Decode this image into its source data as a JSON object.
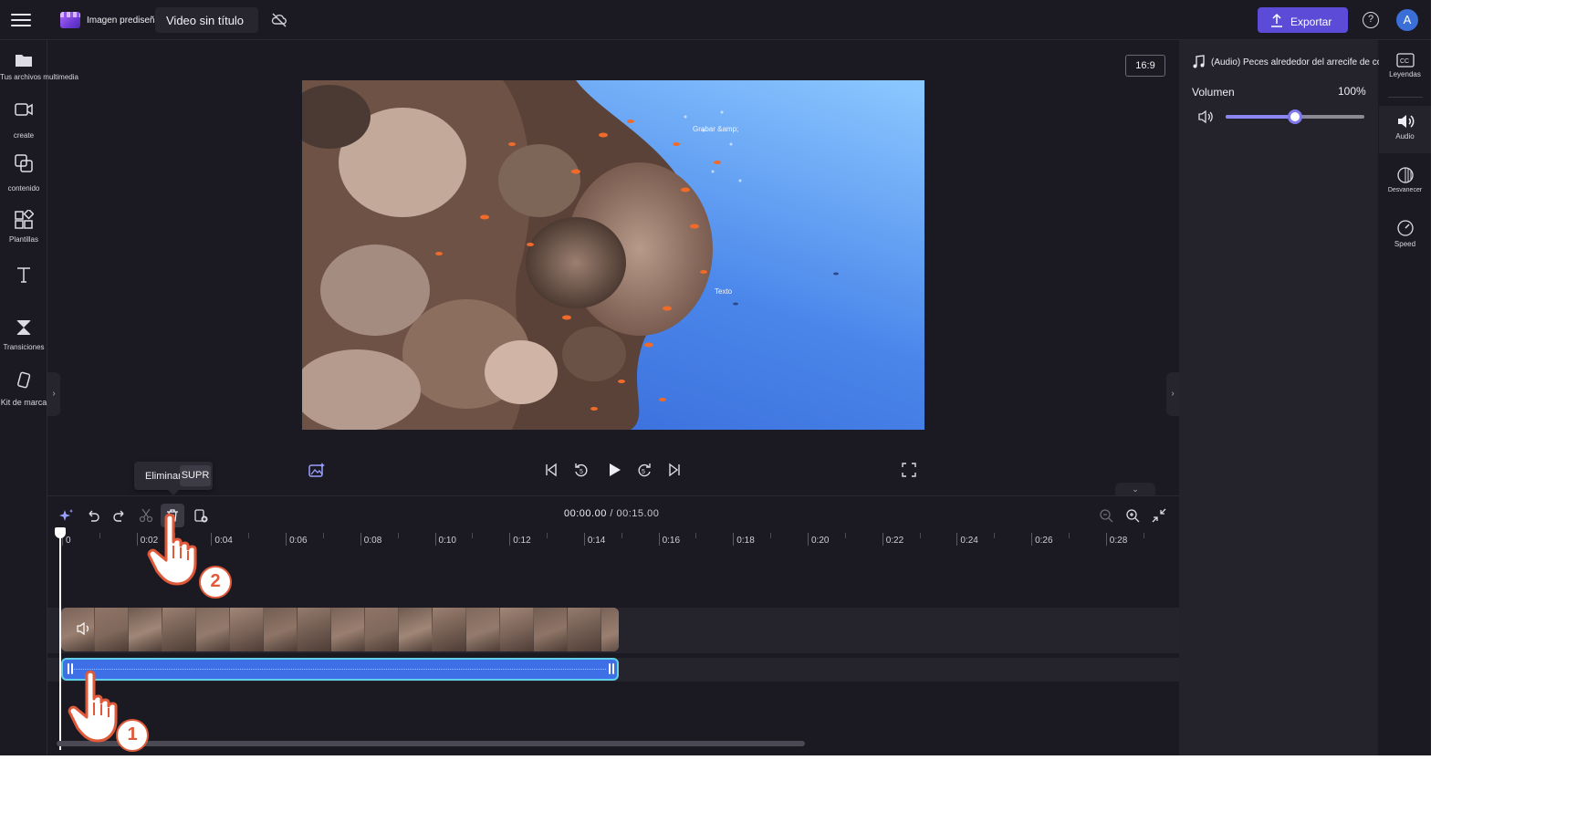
{
  "topbar": {
    "logo_text": "Imagen prediseñada",
    "project_title": "Video sin título",
    "export_label": "Exportar",
    "help_label": "?",
    "avatar_initial": "A",
    "icons": [
      "menu-icon",
      "clipchamp-logo",
      "cloud-off-icon",
      "upload-icon",
      "help-icon"
    ]
  },
  "sidebar": {
    "items": [
      {
        "label": "Tus archivos multimedia",
        "icon": "folder-icon"
      },
      {
        "label": "create",
        "icon": "camera-icon"
      },
      {
        "label": "contenido",
        "icon": "stock-content-icon"
      },
      {
        "label": "Plantillas",
        "icon": "templates-icon"
      },
      {
        "label": "",
        "icon": "text-icon"
      },
      {
        "label": "Transiciones",
        "icon": "transitions-icon"
      },
      {
        "label": "Kit de marca",
        "icon": "brand-kit-icon"
      }
    ]
  },
  "preview": {
    "aspect_ratio": "16:9",
    "overlay_text_1": "Grabar &amp;",
    "overlay_text_2": "Texto",
    "video_colors": {
      "water_light": "#7ab8ff",
      "water_dark": "#3b73e0"
    }
  },
  "playback": {
    "icons": [
      "magic-background-icon",
      "skip-start-icon",
      "rewind-5-icon",
      "play-icon",
      "forward-5-icon",
      "skip-end-icon",
      "fullscreen-icon"
    ]
  },
  "right_panel": {
    "track_title": "(Audio) Peces alrededor del arrecife de coral",
    "volume_label": "Volumen",
    "volume_value": "100%",
    "volume_fraction": 0.5
  },
  "right_tabs": {
    "items": [
      {
        "label": "Leyendas",
        "icon": "captions-icon",
        "active": false
      },
      {
        "label": "Audio",
        "icon": "speaker-icon",
        "active": true
      },
      {
        "label": "Desvanecer",
        "icon": "fade-icon",
        "active": false
      },
      {
        "label": "Speed",
        "icon": "speed-icon",
        "active": false
      }
    ]
  },
  "timeline": {
    "current_time": "00:00.00",
    "separator": " / ",
    "total_time": "00:15.00",
    "ruler_labels": [
      "0",
      "0:02",
      "0:04",
      "0:06",
      "0:08",
      "0:10",
      "0:12",
      "0:14",
      "0:16",
      "0:18",
      "0:20",
      "0:22",
      "0:24",
      "0:26",
      "0:28"
    ],
    "tooltip": {
      "text": "Eliminar",
      "shortcut": "SUPR"
    },
    "audio_clip_color": "#3f6fe6",
    "audio_clip_border": "#5fd0e6"
  },
  "annotations": {
    "step_1": "1",
    "step_2": "2",
    "accent": "#e05a3a"
  },
  "colors": {
    "app_bg": "#1b1a22",
    "panel_bg": "#24232c",
    "accent": "#5b4bd6"
  }
}
